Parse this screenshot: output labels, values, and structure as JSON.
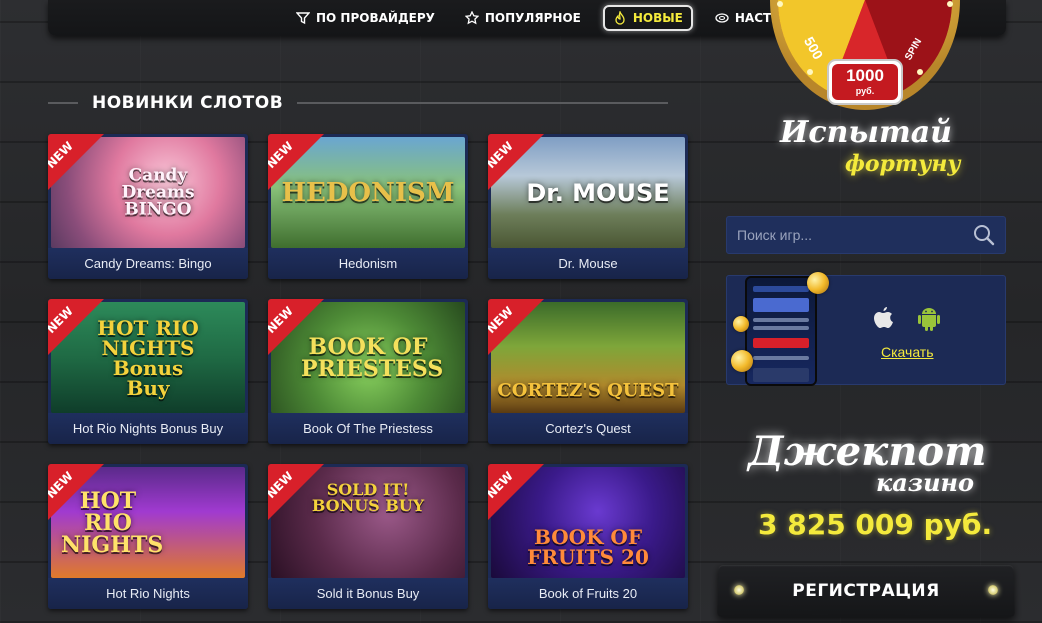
{
  "nav": {
    "items": [
      {
        "label": "ПО ПРОВАЙДЕРУ",
        "icon": "filter-icon",
        "active": false
      },
      {
        "label": "ПОПУЛЯРНОЕ",
        "icon": "star-icon",
        "active": true
      },
      {
        "label": "НОВЫЕ",
        "icon": "flame-icon",
        "active": true
      },
      {
        "label": "НАСТОЛЬНЫЕ",
        "icon": "chip-icon",
        "active": false
      }
    ]
  },
  "section": {
    "title": "НОВИНКИ СЛОТОВ"
  },
  "badge": "NEW",
  "games": [
    {
      "name": "Candy Dreams: Bingo",
      "art": "Candy Dreams BINGO"
    },
    {
      "name": "Hedonism",
      "art": "HEDONISM"
    },
    {
      "name": "Dr. Mouse",
      "art": "Dr. MOUSE"
    },
    {
      "name": "Hot Rio Nights Bonus Buy",
      "art": "HOT RIO NIGHTS Bonus Buy"
    },
    {
      "name": "Book Of The Priestess",
      "art": "BOOK OF PRIESTESS"
    },
    {
      "name": "Cortez's Quest",
      "art": "CORTEZ'S QUEST"
    },
    {
      "name": "Hot Rio Nights",
      "art": "HOT RIO NIGHTS"
    },
    {
      "name": "Sold it Bonus Buy",
      "art": "SOLD IT! BONUS BUY"
    },
    {
      "name": "Book of Fruits 20",
      "art": "BOOK OF FRUITS 20"
    }
  ],
  "wheel": {
    "segment_main": "1000",
    "segment_unit": "руб.",
    "segment_left": "500",
    "segment_right": "SPIN"
  },
  "fortune": {
    "line1": "Испытай",
    "line2": "фортуну"
  },
  "search": {
    "placeholder": "Поиск игр..."
  },
  "app": {
    "download_label": "Скачать"
  },
  "jackpot": {
    "line1": "Джекпот",
    "line2": "казино",
    "amount": "3 825 009 руб."
  },
  "register": {
    "label": "РЕГИСТРАЦИЯ"
  },
  "colors": {
    "accent_yellow": "#f4ea3c",
    "card_blue": "#1c2a55",
    "ribbon_red": "#d8202a"
  }
}
